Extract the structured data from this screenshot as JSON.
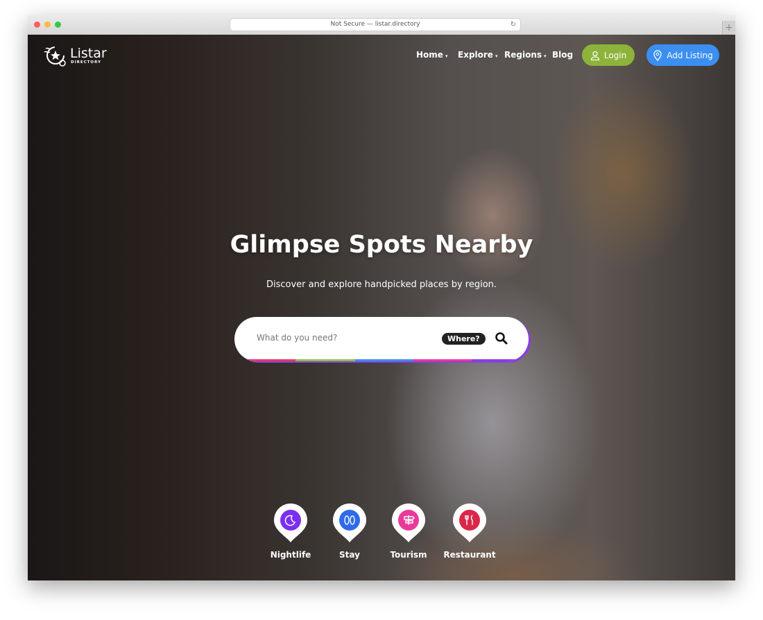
{
  "browser": {
    "url": "Not Secure — listar.directory",
    "new_tab": "+"
  },
  "logo": {
    "name": "Listar",
    "sub": "DIRECTORY"
  },
  "nav": {
    "items": [
      {
        "label": "Home",
        "caret": "▾"
      },
      {
        "label": "Explore",
        "caret": "▾"
      },
      {
        "label": "Regions",
        "caret": "▾"
      },
      {
        "label": "Blog"
      }
    ],
    "login": "Login",
    "add_listing": "Add Listing",
    "login_color": "#8db33a",
    "add_color": "#3b8ff0"
  },
  "hero": {
    "title": "Glimpse Spots Nearby",
    "subtitle": "Discover and explore handpicked places by region."
  },
  "search": {
    "placeholder": "What do you need?",
    "where": "Where?"
  },
  "categories": [
    {
      "label": "Nightlife",
      "icon": "moon-icon",
      "color": "#7b2ff0"
    },
    {
      "label": "Stay",
      "icon": "flip-flops-icon",
      "color": "#2f6be6"
    },
    {
      "label": "Tourism",
      "icon": "signpost-icon",
      "color": "#e9399a"
    },
    {
      "label": "Restaurant",
      "icon": "fork-knife-icon",
      "color": "#d9274a"
    }
  ]
}
